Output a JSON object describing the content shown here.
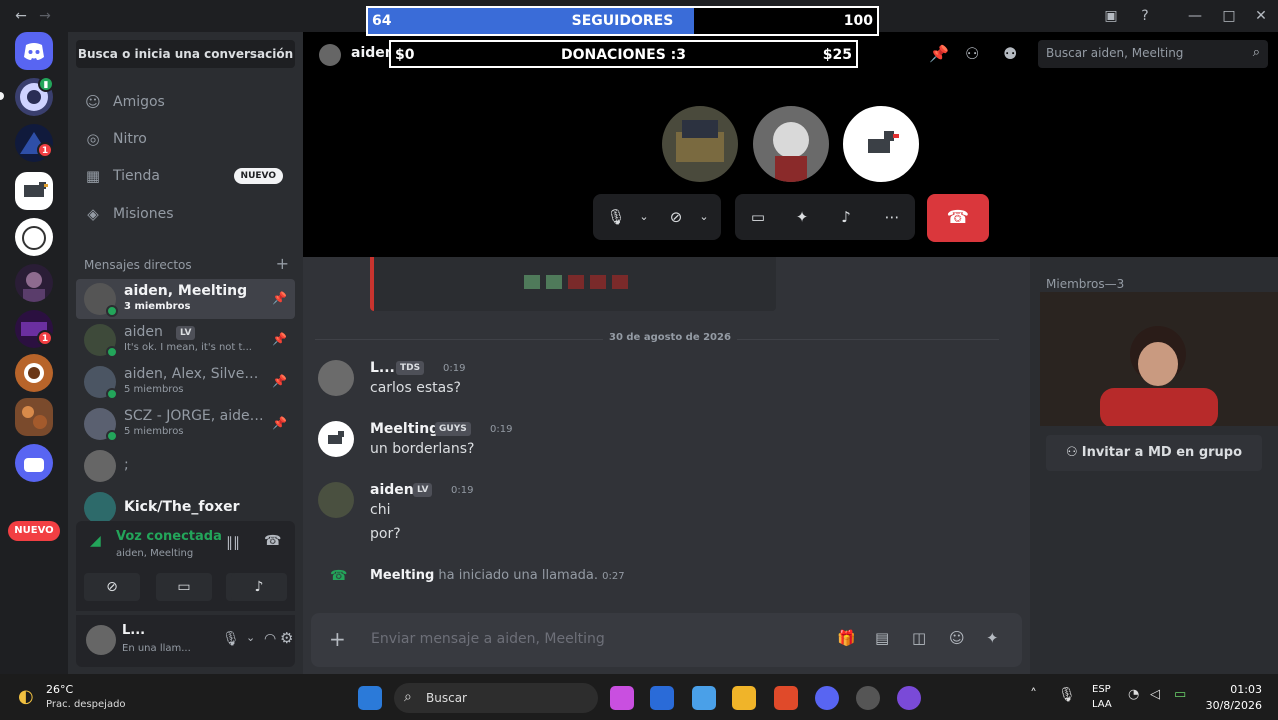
{
  "overlay": {
    "followers_current": "64",
    "followers_label": "SEGUIDORES",
    "followers_goal": "100",
    "followers_progress": 0.64,
    "donations_current": "$0",
    "donations_label": "DONACIONES :3",
    "donations_goal": "$25"
  },
  "dm_sidebar": {
    "search_label": "Busca o inicia una conversación",
    "nav": [
      {
        "label": "Amigos"
      },
      {
        "label": "Nitro"
      },
      {
        "label": "Tienda",
        "tag": "NUEVO"
      },
      {
        "label": "Misiones"
      }
    ],
    "heading": "Mensajes directos",
    "items": [
      {
        "name": "aiden, Meelting",
        "sub": "3 miembros"
      },
      {
        "name": "aiden",
        "sub": "It's ok. I mean, it's not t..."
      },
      {
        "name": "aiden, Alex, SilverCr...",
        "sub": "5 miembros"
      },
      {
        "name": "SCZ - JORGE, aiden,...",
        "sub": "5 miembros"
      },
      {
        "name": ";",
        "sub": ""
      },
      {
        "name": "Kick/The_foxer",
        "sub": ""
      }
    ]
  },
  "rail": {
    "nuevo_label": "NUEVO",
    "badges": [
      "1",
      "1"
    ]
  },
  "voice": {
    "title": "Voz conectada",
    "subtitle": "aiden, Meelting"
  },
  "user": {
    "name": "L...",
    "status": "En una llam..."
  },
  "call": {
    "channel_name": "aiden, Meelting",
    "search_placeholder": "Buscar aiden, Meelting"
  },
  "chat": {
    "date_divider": "30 de agosto de 2026",
    "messages": [
      {
        "author": "L...",
        "tag": "TDS",
        "time": "0:19",
        "lines": [
          "carlos estas?"
        ]
      },
      {
        "author": "Meelting",
        "tag": "GUYS",
        "time": "0:19",
        "lines": [
          "un borderlans?"
        ]
      },
      {
        "author": "aiden",
        "tag": "LV",
        "time": "0:19",
        "lines": [
          "chi",
          "por?"
        ]
      }
    ],
    "system": {
      "author": "Meelting",
      "text": "ha iniciado una llamada.",
      "time": "0:27"
    },
    "input_placeholder": "Enviar mensaje a aiden, Meelting"
  },
  "members": {
    "heading": "Miembros—3",
    "invite_label": "Invitar a MD en grupo"
  },
  "taskbar": {
    "weather_temp": "26°C",
    "weather_desc": "Prac. despejado",
    "search_label": "Buscar",
    "lang": "ESP",
    "lang2": "LAA",
    "time": "01:03",
    "date": "30/8/2026"
  }
}
